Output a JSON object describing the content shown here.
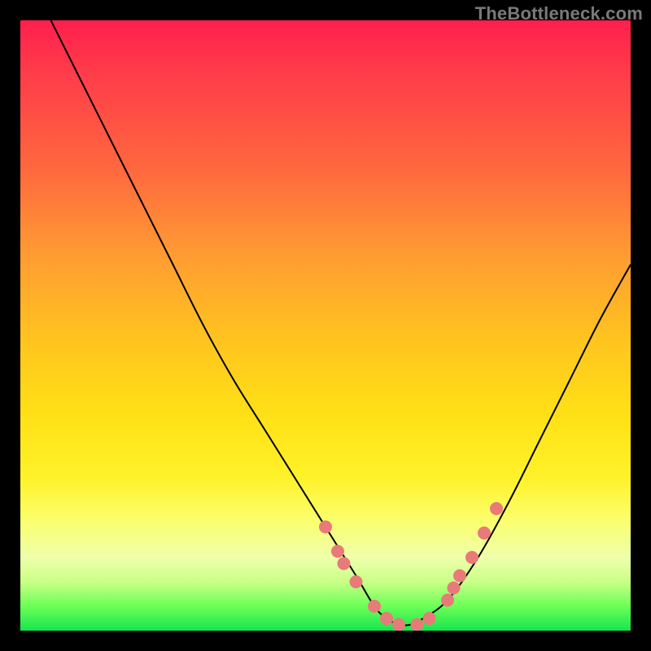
{
  "watermark": "TheBottleneck.com",
  "colors": {
    "background": "#000000",
    "curve": "#000000",
    "marker": "#e87a7a",
    "gradient_top": "#ff1f4d",
    "gradient_bottom": "#16e54e"
  },
  "chart_data": {
    "type": "line",
    "title": "",
    "xlabel": "",
    "ylabel": "",
    "xlim": [
      0,
      100
    ],
    "ylim": [
      0,
      100
    ],
    "grid": false,
    "legend": false,
    "annotations": [
      "TheBottleneck.com"
    ],
    "series": [
      {
        "name": "bottleneck-curve",
        "x": [
          5,
          10,
          15,
          20,
          25,
          30,
          35,
          40,
          45,
          50,
          55,
          58,
          60,
          62,
          64,
          66,
          70,
          75,
          80,
          85,
          90,
          95,
          100
        ],
        "y": [
          100,
          90,
          80,
          70,
          60,
          50,
          41,
          33,
          25,
          17,
          9,
          4,
          2,
          1,
          1,
          2,
          5,
          12,
          21,
          31,
          41,
          51,
          60
        ]
      }
    ],
    "markers": {
      "name": "highlight-dots",
      "x": [
        50,
        52,
        53,
        55,
        58,
        60,
        62,
        65,
        67,
        70,
        71,
        72,
        74,
        76,
        78
      ],
      "y": [
        17,
        13,
        11,
        8,
        4,
        2,
        1,
        1,
        2,
        5,
        7,
        9,
        12,
        16,
        20
      ]
    }
  }
}
